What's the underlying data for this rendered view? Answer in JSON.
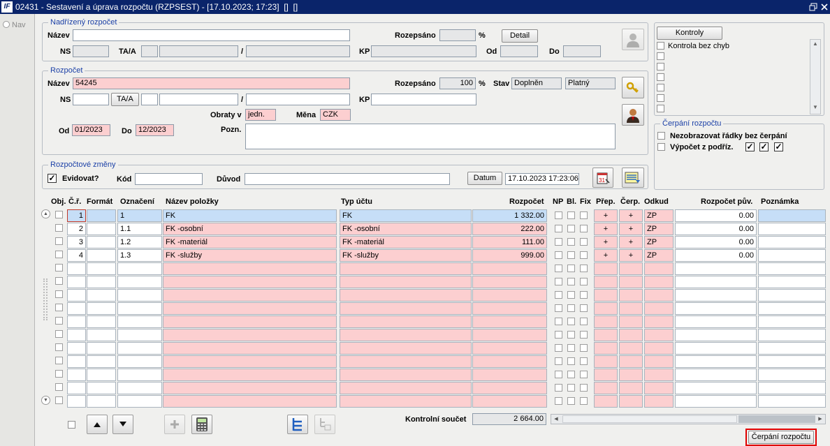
{
  "titlebar": {
    "text": "02431 - Sestavení a úprava rozpočtu (RZPSEST) - [17.10.2023; 17:23]  []  []",
    "logo": "IF",
    "restore_icon": "restore-icon",
    "close_icon": "close-icon"
  },
  "nav": {
    "label": "Nav"
  },
  "parent": {
    "title": "Nadřízený rozpočet",
    "nazev_label": "Název",
    "nazev_value": "",
    "rozepsano_label": "Rozepsáno",
    "rozepsano_value": "",
    "pct": "%",
    "detail_button": "Detail",
    "ns_label": "NS",
    "taa_label": "TA/A",
    "slash": "/",
    "kp_label": "KP",
    "od_label": "Od",
    "do_label": "Do"
  },
  "budget": {
    "title": "Rozpočet",
    "nazev_label": "Název",
    "nazev_value": "54245",
    "rozepsano_label": "Rozepsáno",
    "rozepsano_value": "100",
    "pct": "%",
    "stav_label": "Stav",
    "stav_value": "Doplněn",
    "stav_value2": "Platný",
    "ns_label": "NS",
    "taa_button": "TA/A",
    "slash": "/",
    "kp_label": "KP",
    "obraty_label": "Obraty v",
    "obraty_value": "jedn.",
    "mena_label": "Měna",
    "mena_value": "CZK",
    "od_label": "Od",
    "od_value": "01/2023",
    "do_label": "Do",
    "do_value": "12/2023",
    "pozn_label": "Pozn.",
    "pozn_value": ""
  },
  "changes": {
    "title": "Rozpočtové změny",
    "evidovat_label": "Evidovat?",
    "evidovat_checked": "✓",
    "kod_label": "Kód",
    "kod_value": "",
    "duvod_label": "Důvod",
    "duvod_value": "",
    "datum_button": "Datum",
    "datum_value": "17.10.2023 17:23:06",
    "calendar_day": "31"
  },
  "kontroly": {
    "button": "Kontroly",
    "items": [
      "Kontrola bez chyb",
      "",
      "",
      "",
      "",
      "",
      "",
      ""
    ]
  },
  "cerpani": {
    "title": "Čerpání rozpočtu",
    "opt1": "Nezobrazovat řádky bez čerpání",
    "opt2": "Výpočet z podříz.",
    "check": "✓"
  },
  "table": {
    "headers": {
      "obj": "Obj.",
      "cr": "Č.ř.",
      "format": "Formát",
      "oznaceni": "Označení",
      "nazev": "Název položky",
      "typ": "Typ účtu",
      "rozpocet": "Rozpočet",
      "np": "NP",
      "bl": "Bl.",
      "fix": "Fix",
      "prep": "Přep.",
      "cerp": "Čerp.",
      "odkud": "Odkud",
      "puv": "Rozpočet pův.",
      "poznamka": "Poznámka"
    },
    "rows": [
      {
        "cr": "1",
        "format": "",
        "oznaceni": "1",
        "nazev": "FK",
        "typ": "FK",
        "rozpocet": "1 332.00",
        "prep": "+",
        "cerp": "+",
        "odkud": "ZP",
        "puv": "0.00"
      },
      {
        "cr": "2",
        "format": "",
        "oznaceni": "1.1",
        "nazev": " FK -osobní",
        "typ": "FK -osobní",
        "rozpocet": "222.00",
        "prep": "+",
        "cerp": "+",
        "odkud": "ZP",
        "puv": "0.00"
      },
      {
        "cr": "3",
        "format": "",
        "oznaceni": "1.2",
        "nazev": " FK -materiál",
        "typ": "FK -materiál",
        "rozpocet": "111.00",
        "prep": "+",
        "cerp": "+",
        "odkud": "ZP",
        "puv": "0.00"
      },
      {
        "cr": "4",
        "format": "",
        "oznaceni": "1.3",
        "nazev": " FK -služby",
        "typ": "FK -služby",
        "rozpocet": "999.00",
        "prep": "+",
        "cerp": "+",
        "odkud": "ZP",
        "puv": "0.00"
      },
      {},
      {},
      {},
      {},
      {},
      {},
      {},
      {},
      {},
      {},
      {}
    ]
  },
  "footer": {
    "kontrolni_label": "Kontrolní součet",
    "kontrolni_value": "2 664.00",
    "cerpani_button": "Čerpání rozpočtu"
  },
  "colors": {
    "titlebar": "#0a246a",
    "pink": "#fccfd0",
    "selected": "#c6def7",
    "group_title": "#1a3fa6",
    "highlight": "#e00000"
  }
}
